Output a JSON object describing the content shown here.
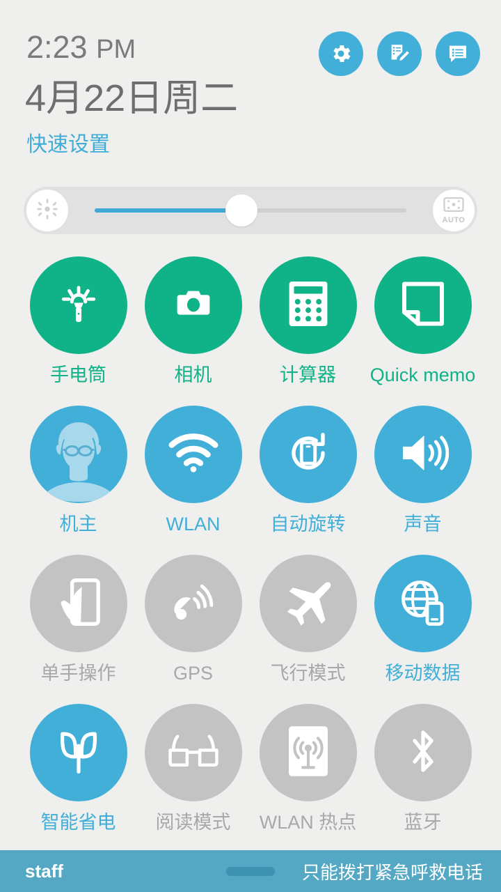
{
  "header": {
    "time": "2:23",
    "ampm": "PM",
    "date": "4月22日周二",
    "quick_settings_label": "快速设置",
    "buttons": [
      {
        "name": "settings-button",
        "icon": "gear-icon"
      },
      {
        "name": "edit-notes-button",
        "icon": "note-edit-icon"
      },
      {
        "name": "notifications-button",
        "icon": "message-list-icon"
      }
    ]
  },
  "brightness": {
    "left_icon": "brightness-low-icon",
    "right_icon": "auto-brightness-icon",
    "auto_label": "AUTO",
    "value_percent": 47
  },
  "toggles": [
    [
      {
        "label": "手电筒",
        "state": "on-green",
        "icon": "flashlight-icon"
      },
      {
        "label": "相机",
        "state": "on-green",
        "icon": "camera-icon"
      },
      {
        "label": "计算器",
        "state": "on-green",
        "icon": "calculator-icon"
      },
      {
        "label": "Quick memo",
        "state": "on-green",
        "icon": "quick-memo-icon"
      }
    ],
    [
      {
        "label": "机主",
        "state": "on-blue",
        "icon": "owner-avatar-icon"
      },
      {
        "label": "WLAN",
        "state": "on-blue",
        "icon": "wifi-icon"
      },
      {
        "label": "自动旋转",
        "state": "on-blue",
        "icon": "auto-rotate-icon"
      },
      {
        "label": "声音",
        "state": "on-blue",
        "icon": "sound-icon"
      }
    ],
    [
      {
        "label": "单手操作",
        "state": "off",
        "icon": "one-hand-operation-icon"
      },
      {
        "label": "GPS",
        "state": "off",
        "icon": "gps-icon"
      },
      {
        "label": "飞行模式",
        "state": "off",
        "icon": "airplane-icon"
      },
      {
        "label": "移动数据",
        "state": "on-blue",
        "icon": "mobile-data-icon"
      }
    ],
    [
      {
        "label": "智能省电",
        "state": "on-blue",
        "icon": "power-saving-icon"
      },
      {
        "label": "阅读模式",
        "state": "off",
        "icon": "reading-mode-icon"
      },
      {
        "label": "WLAN 热点",
        "state": "off",
        "icon": "hotspot-icon"
      },
      {
        "label": "蓝牙",
        "state": "off",
        "icon": "bluetooth-icon"
      }
    ]
  ],
  "bottom": {
    "carrier": "staff",
    "emergency_text": "只能拨打紧急呼救电话",
    "handle": "drag-handle"
  },
  "colors": {
    "background": "#efefee",
    "accent_blue": "#41afd7",
    "accent_green": "#10b287",
    "off_gray": "#c3c3c3",
    "bottom_bar": "#54a8c4"
  }
}
